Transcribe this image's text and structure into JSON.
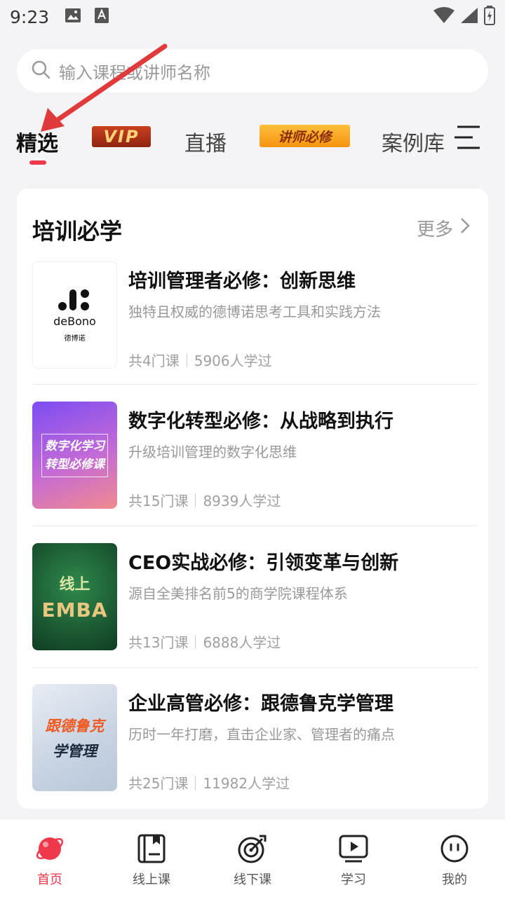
{
  "status_bar": {
    "time": "9:23"
  },
  "search": {
    "placeholder": "输入课程或讲师名称"
  },
  "tabs": [
    {
      "label": "精选",
      "active": true
    },
    {
      "label": "VIP"
    },
    {
      "label": "直播"
    },
    {
      "label": "讲师必修"
    },
    {
      "label": "案例库"
    }
  ],
  "section": {
    "title": "培训必学",
    "more_label": "更多"
  },
  "courses": [
    {
      "title": "培训管理者必修：创新思维",
      "desc": "独特且权威的德博诺思考工具和实践方法",
      "lessons": "共4门课",
      "learners": "5906人学过",
      "thumb_lines": [
        "deBono",
        "德博诺"
      ]
    },
    {
      "title": "数字化转型必修：从战略到执行",
      "desc": "升级培训管理的数字化思维",
      "lessons": "共15门课",
      "learners": "8939人学过",
      "thumb_lines": [
        "数字化学习",
        "转型必修课"
      ]
    },
    {
      "title": "CEO实战必修：引领变革与创新",
      "desc": "源自全美排名前5的商学院课程体系",
      "lessons": "共13门课",
      "learners": "6888人学过",
      "thumb_lines": [
        "线上",
        "EMBA"
      ]
    },
    {
      "title": "企业高管必修：跟德鲁克学管理",
      "desc": "历时一年打磨，直击企业家、管理者的痛点",
      "lessons": "共25门课",
      "learners": "11982人学过",
      "thumb_lines": [
        "跟德鲁克",
        "学管理"
      ]
    }
  ],
  "bottom_nav": [
    {
      "label": "首页",
      "icon": "planet-icon",
      "active": true
    },
    {
      "label": "线上课",
      "icon": "book-icon"
    },
    {
      "label": "线下课",
      "icon": "target-icon"
    },
    {
      "label": "学习",
      "icon": "play-screen-icon"
    },
    {
      "label": "我的",
      "icon": "face-icon"
    }
  ],
  "colors": {
    "accent": "#f0384b",
    "vip": "#b3321a",
    "lecturer_badge": "#f7a123"
  }
}
